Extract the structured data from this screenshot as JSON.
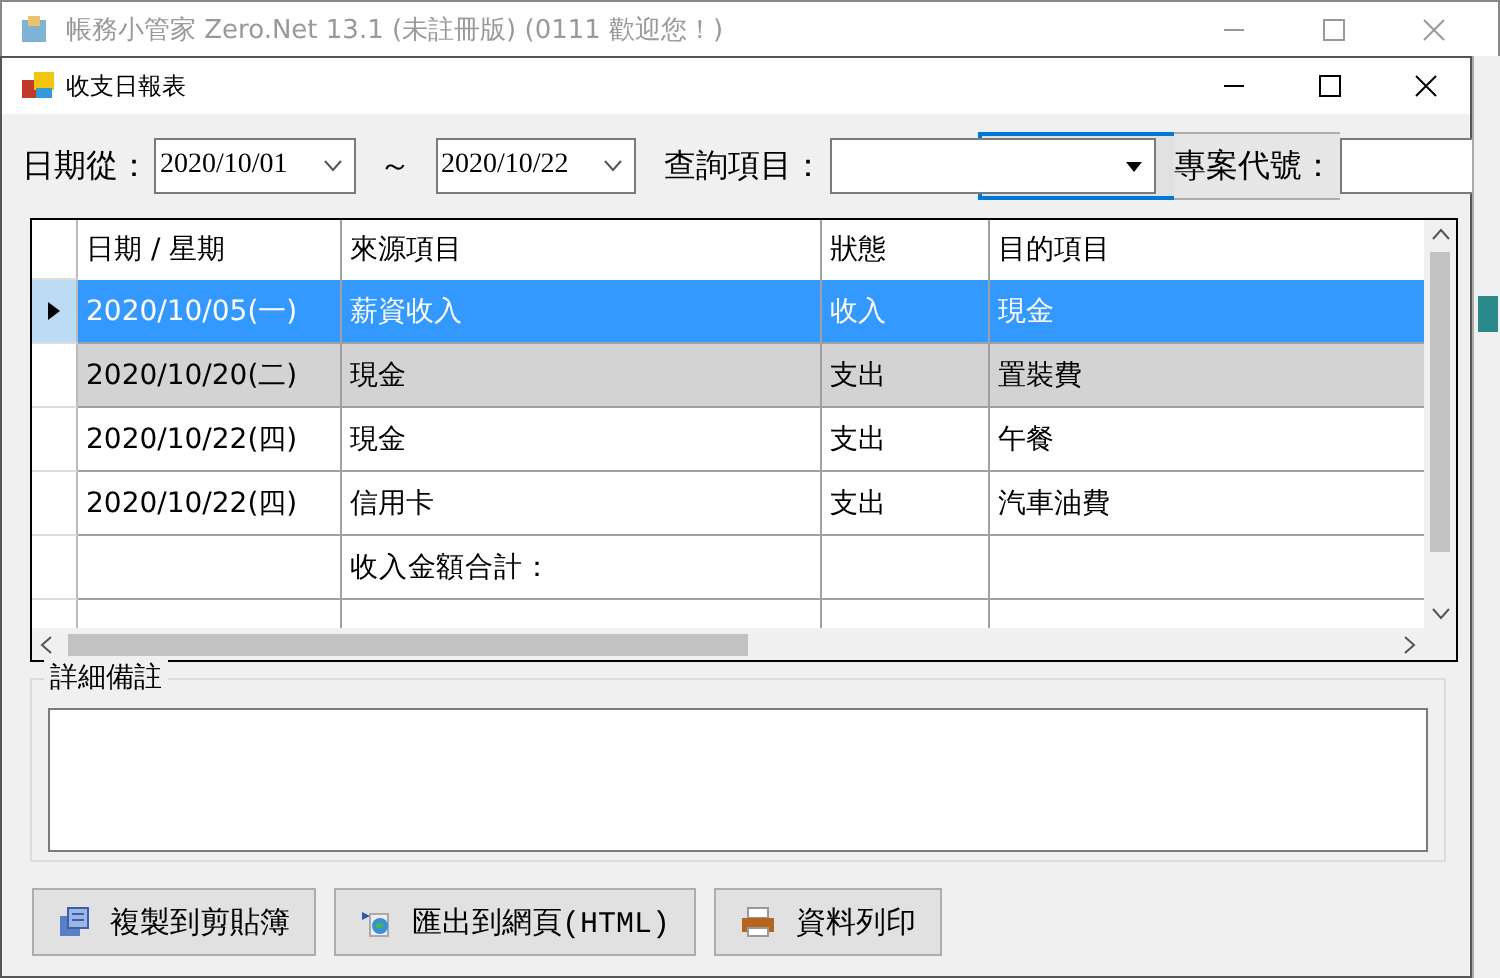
{
  "app_window": {
    "title": "帳務小管家 Zero.Net 13.1 (未註冊版) (0111 歡迎您！)"
  },
  "dialog": {
    "title": "收支日報表"
  },
  "filters": {
    "date_from_label": "日期從：",
    "date_from": "2020/10/01",
    "range_sep": "～",
    "date_to": "2020/10/22",
    "query_label": "查詢項目：",
    "project_label": "專案代號："
  },
  "table": {
    "columns": [
      "日期 / 星期",
      "來源項目",
      "狀態",
      "目的項目"
    ],
    "rows": [
      {
        "kind": "data",
        "selected": true,
        "highlighted": false,
        "cells": [
          "2020/10/05(一)",
          "薪資收入",
          "收入",
          "現金"
        ]
      },
      {
        "kind": "data",
        "selected": false,
        "highlighted": true,
        "cells": [
          "2020/10/20(二)",
          "現金",
          "支出",
          "置裝費"
        ]
      },
      {
        "kind": "data",
        "selected": false,
        "highlighted": false,
        "cells": [
          "2020/10/22(四)",
          "現金",
          "支出",
          "午餐"
        ]
      },
      {
        "kind": "data",
        "selected": false,
        "highlighted": false,
        "cells": [
          "2020/10/22(四)",
          "信用卡",
          "支出",
          "汽車油費"
        ]
      },
      {
        "kind": "total",
        "selected": false,
        "highlighted": false,
        "cells": [
          "",
          "收入金額合計：",
          "",
          ""
        ]
      }
    ]
  },
  "notes": {
    "label": "詳細備註"
  },
  "buttons": [
    {
      "kind": "copy",
      "label": "複製到剪貼簿"
    },
    {
      "kind": "html",
      "label": "匯出到網頁(HTML)"
    },
    {
      "kind": "print",
      "label": "資料列印"
    }
  ]
}
